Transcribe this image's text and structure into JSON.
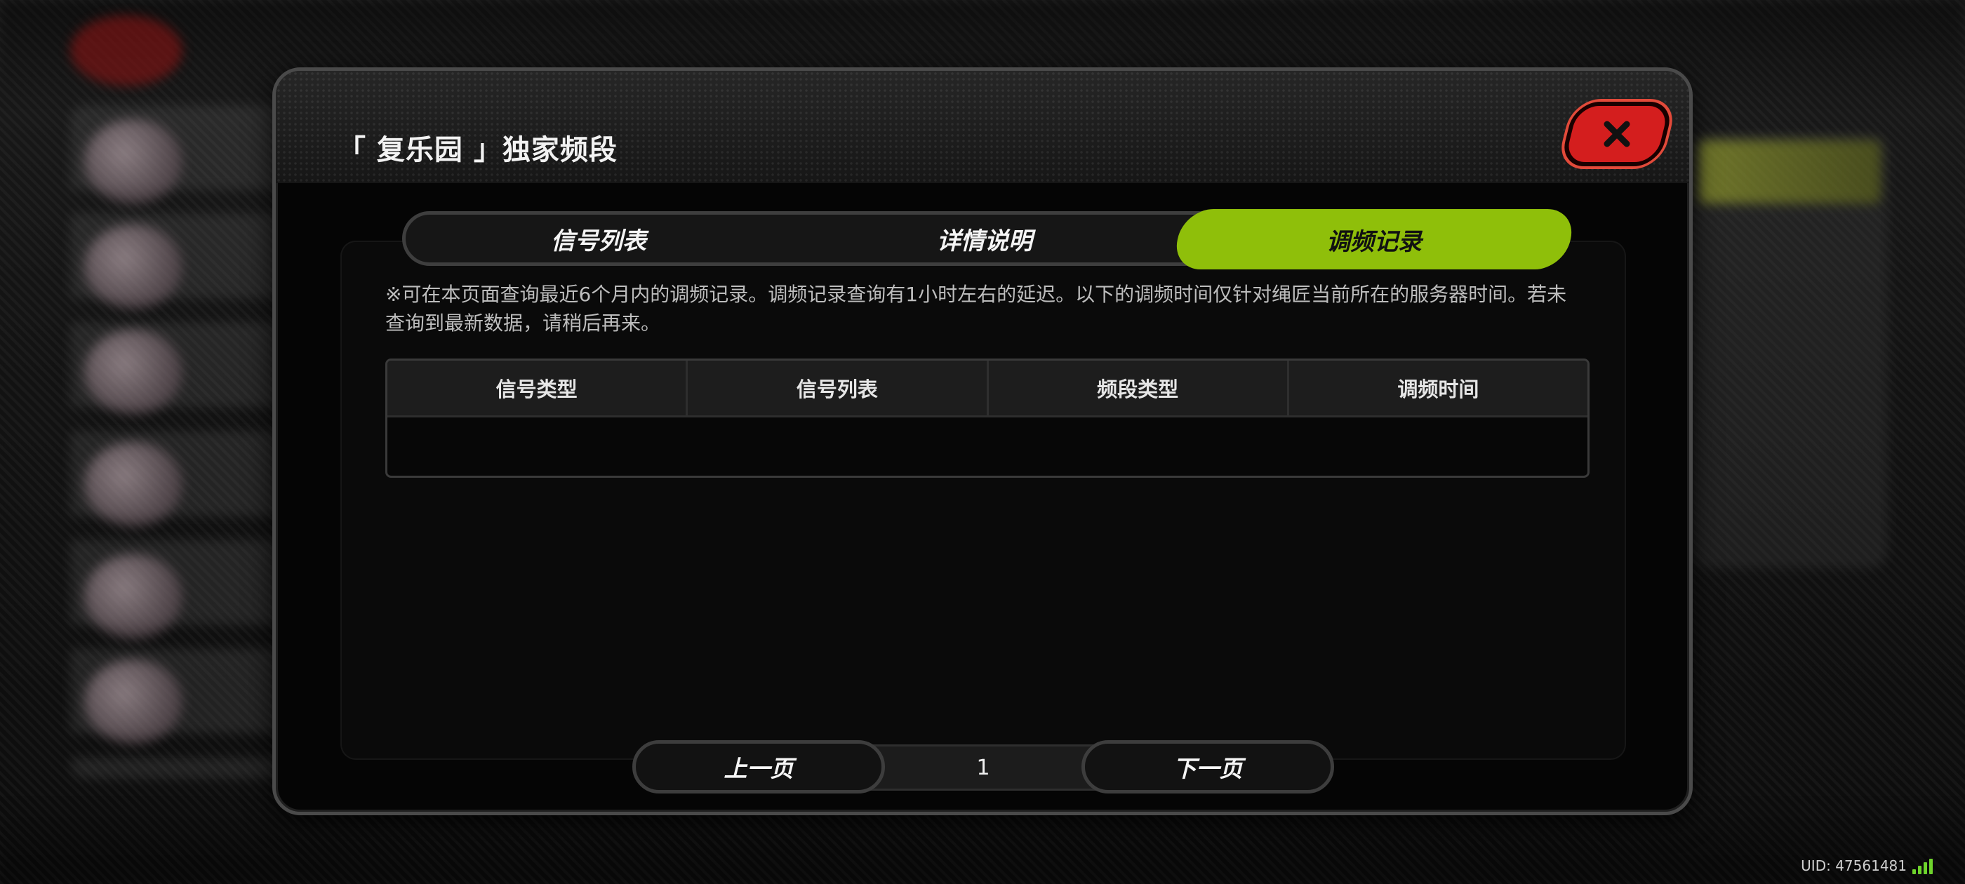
{
  "dialog": {
    "title": "「 复乐园 」独家频段",
    "close_icon": "close-x-icon"
  },
  "tabs": [
    {
      "label": "信号列表",
      "active": false
    },
    {
      "label": "详情说明",
      "active": false
    },
    {
      "label": "调频记录",
      "active": true
    }
  ],
  "note": "※可在本页面查询最近6个月内的调频记录。调频记录查询有1小时左右的延迟。以下的调频时间仅针对绳匠当前所在的服务器时间。若未查询到最新数据，请稍后再来。",
  "table": {
    "columns": [
      "信号类型",
      "信号列表",
      "频段类型",
      "调频时间"
    ],
    "rows": []
  },
  "pagination": {
    "prev_label": "上一页",
    "page": "1",
    "next_label": "下一页"
  },
  "footer": {
    "uid": "UID: 47561481"
  },
  "colors": {
    "accent": "#8fbf0a",
    "close": "#d41e1e"
  }
}
